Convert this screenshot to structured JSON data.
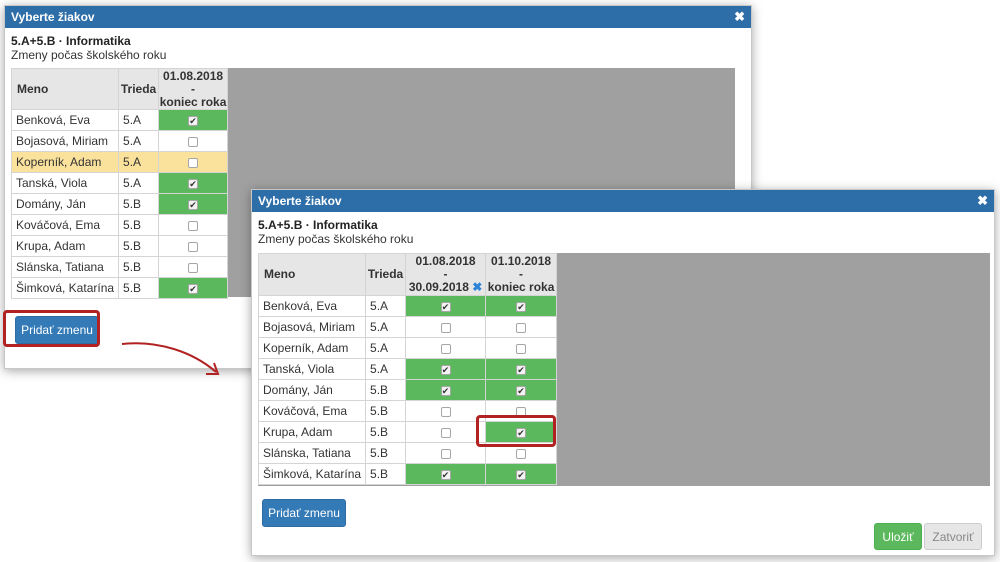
{
  "dialog_title": "Vyberte žiakov",
  "close_glyph": "✖",
  "subject": "5.A+5.B · Informatika",
  "subtitle": "Zmeny počas školského roku",
  "col_name": "Meno",
  "col_class": "Trieda",
  "add_change_label": "Pridať zmenu",
  "save_label": "Uložiť",
  "close_label": "Zatvoriť",
  "check_glyph": "✔",
  "remove_period_glyph": "✖",
  "dialog1": {
    "period": {
      "line1": "01.08.2018",
      "line2": "-",
      "line3": "koniec roka"
    },
    "rows": [
      {
        "name": "Benková, Eva",
        "class": "5.A",
        "p1": true
      },
      {
        "name": "Bojasová, Miriam",
        "class": "5.A",
        "p1": false
      },
      {
        "name": "Koperník, Adam",
        "class": "5.A",
        "p1": false,
        "highlight": true
      },
      {
        "name": "Tanská, Viola",
        "class": "5.A",
        "p1": true
      },
      {
        "name": "Domány, Ján",
        "class": "5.B",
        "p1": true
      },
      {
        "name": "Kováčová, Ema",
        "class": "5.B",
        "p1": false
      },
      {
        "name": "Krupa, Adam",
        "class": "5.B",
        "p1": false
      },
      {
        "name": "Slánska, Tatiana",
        "class": "5.B",
        "p1": false
      },
      {
        "name": "Šimková, Katarína",
        "class": "5.B",
        "p1": true
      }
    ]
  },
  "dialog2": {
    "period1": {
      "line1": "01.08.2018",
      "line2": "-",
      "line3": "30.09.2018"
    },
    "period2": {
      "line1": "01.10.2018",
      "line2": "-",
      "line3": "koniec roka"
    },
    "rows": [
      {
        "name": "Benková, Eva",
        "class": "5.A",
        "p1": true,
        "p2": true
      },
      {
        "name": "Bojasová, Miriam",
        "class": "5.A",
        "p1": false,
        "p2": false
      },
      {
        "name": "Koperník, Adam",
        "class": "5.A",
        "p1": false,
        "p2": false
      },
      {
        "name": "Tanská, Viola",
        "class": "5.A",
        "p1": true,
        "p2": true
      },
      {
        "name": "Domány, Ján",
        "class": "5.B",
        "p1": true,
        "p2": true
      },
      {
        "name": "Kováčová, Ema",
        "class": "5.B",
        "p1": false,
        "p2": false
      },
      {
        "name": "Krupa, Adam",
        "class": "5.B",
        "p1": false,
        "p2": true
      },
      {
        "name": "Slánska, Tatiana",
        "class": "5.B",
        "p1": false,
        "p2": false
      },
      {
        "name": "Šimková, Katarína",
        "class": "5.B",
        "p1": true,
        "p2": true
      }
    ]
  },
  "colors": {
    "title_bar": "#2d6ea8",
    "checked_cell": "#5cb85c",
    "highlight_row": "#fbe29c",
    "annotation": "#b22222"
  }
}
